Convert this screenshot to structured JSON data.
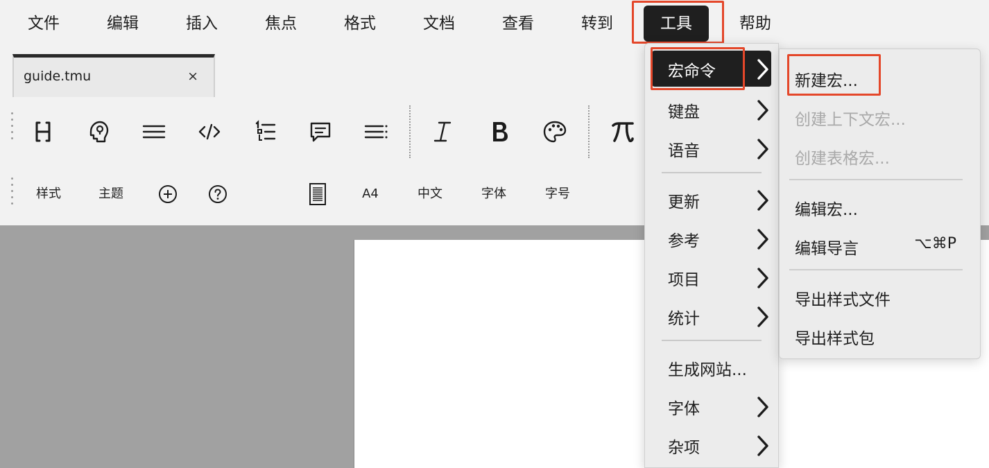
{
  "menubar": {
    "items": [
      "文件",
      "编辑",
      "插入",
      "焦点",
      "格式",
      "文档",
      "查看",
      "转到",
      "工具",
      "帮助"
    ],
    "active_index": 8
  },
  "tab": {
    "label": "guide.tmu",
    "close": "×"
  },
  "toolbar_icons": [
    "heading-icon",
    "idea-icon",
    "paragraph-icon",
    "code-icon",
    "ordered-list-icon",
    "comment-icon",
    "align-icon",
    "italic-icon",
    "bold-icon",
    "palette-icon",
    "pi-icon"
  ],
  "toolbar2": {
    "style": "样式",
    "theme": "主题",
    "page_size": "A4",
    "language": "中文",
    "font": "字体",
    "font_size": "字号"
  },
  "tools_menu": {
    "items": [
      {
        "label": "宏命令",
        "submenu": true
      },
      {
        "label": "键盘",
        "submenu": true
      },
      {
        "label": "语音",
        "submenu": true
      },
      {
        "label": "更新",
        "submenu": true
      },
      {
        "label": "参考",
        "submenu": true
      },
      {
        "label": "项目",
        "submenu": true
      },
      {
        "label": "统计",
        "submenu": true
      },
      {
        "label": "生成网站...",
        "submenu": false
      },
      {
        "label": "字体",
        "submenu": true
      },
      {
        "label": "杂项",
        "submenu": true
      }
    ]
  },
  "macro_submenu": {
    "items": [
      {
        "label": "新建宏...",
        "enabled": true,
        "shortcut": ""
      },
      {
        "label": "创建上下文宏...",
        "enabled": false,
        "shortcut": ""
      },
      {
        "label": "创建表格宏...",
        "enabled": false,
        "shortcut": ""
      },
      {
        "label": "编辑宏...",
        "enabled": true,
        "shortcut": ""
      },
      {
        "label": "编辑导言",
        "enabled": true,
        "shortcut": "⌥⌘P"
      },
      {
        "label": "导出样式文件",
        "enabled": true,
        "shortcut": ""
      },
      {
        "label": "导出样式包",
        "enabled": true,
        "shortcut": ""
      }
    ]
  },
  "colors": {
    "highlight": "#e4472a",
    "menu_active_bg": "#1f1f1f",
    "disabled_text": "#a9a9a9"
  }
}
